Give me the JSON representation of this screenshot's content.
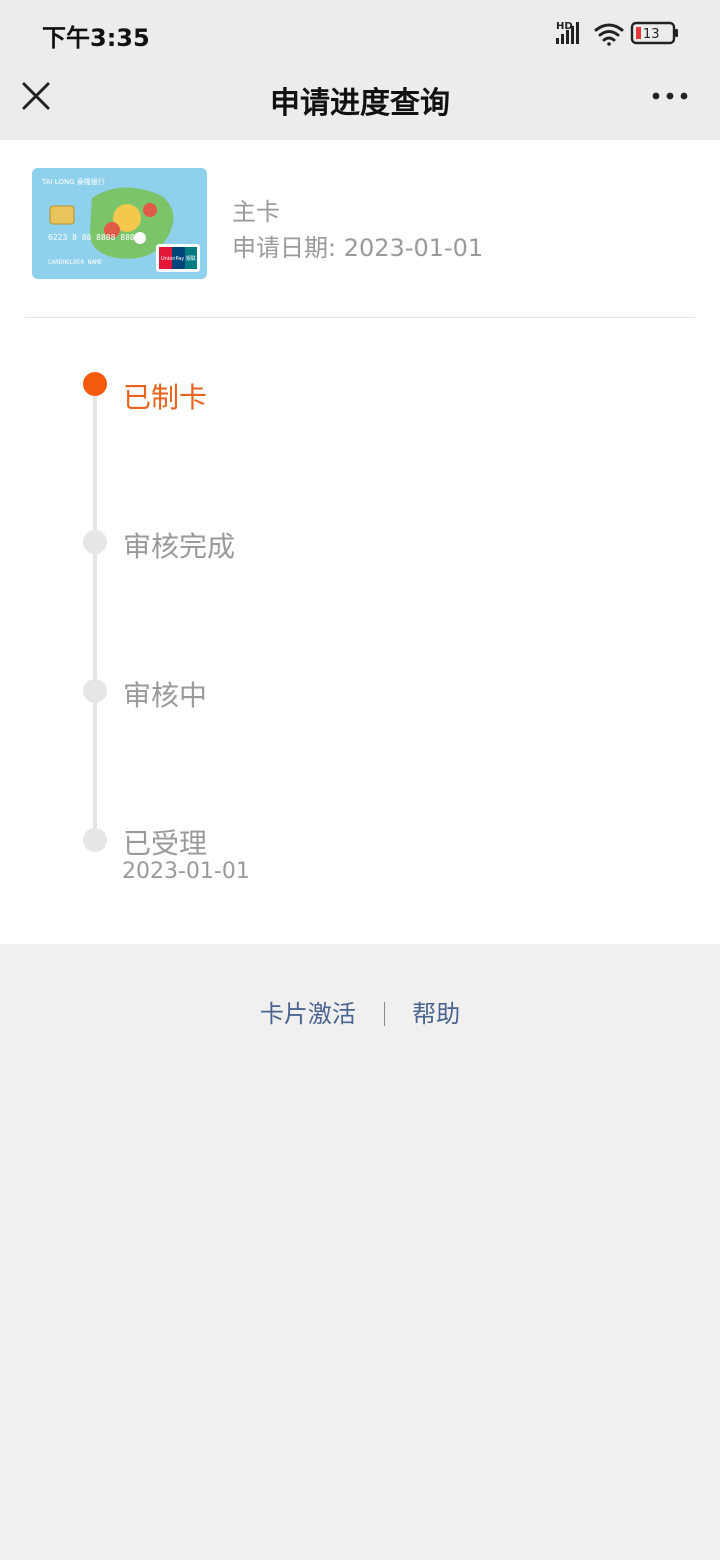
{
  "status_bar": {
    "time": "下午3:35",
    "network_label": "HD",
    "battery_level": "13",
    "icons": [
      "signal-icon",
      "wifi-icon",
      "battery-icon"
    ]
  },
  "nav": {
    "title": "申请进度查询",
    "close_icon": "close-icon",
    "more_icon": "more-icon"
  },
  "card": {
    "type": "主卡",
    "apply_date": "申请日期: 2023-01-01",
    "image_alt": "泰隆银行信用卡",
    "card_text": {
      "bank": "TAI LONG 泰隆银行",
      "number": "6223 8 88 8888 8888",
      "holder": "CARDHOLDER NAME",
      "brand": "UnionPay 银联"
    }
  },
  "timeline": {
    "steps": [
      {
        "label": "已制卡",
        "date": "",
        "status": "active"
      },
      {
        "label": "审核完成",
        "date": "",
        "status": "pending"
      },
      {
        "label": "审核中",
        "date": "",
        "status": "pending"
      },
      {
        "label": "已受理",
        "date": "2023-01-01",
        "status": "pending"
      }
    ]
  },
  "footer": {
    "activate_label": "卡片激活",
    "help_label": "帮助"
  },
  "colors": {
    "accent": "#f55a0c",
    "link": "#4b648f",
    "muted": "#9a9a9a"
  }
}
